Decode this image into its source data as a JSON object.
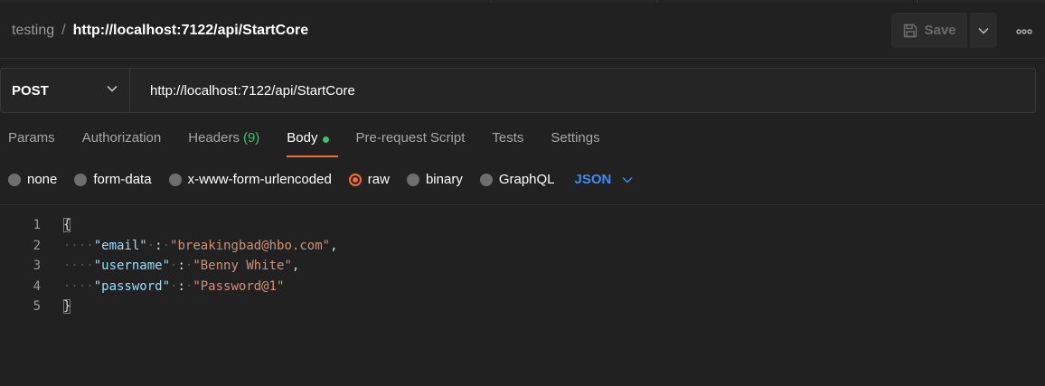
{
  "header": {
    "breadcrumb_parent": "testing",
    "breadcrumb_separator": "/",
    "breadcrumb_current": "http://localhost:7122/api/StartCore",
    "save_label": "Save"
  },
  "request": {
    "method": "POST",
    "url": "http://localhost:7122/api/StartCore"
  },
  "tabs": [
    {
      "label": "Params"
    },
    {
      "label": "Authorization"
    },
    {
      "label": "Headers",
      "count": "(9)"
    },
    {
      "label": "Body",
      "active": true
    },
    {
      "label": "Pre-request Script"
    },
    {
      "label": "Tests"
    },
    {
      "label": "Settings"
    }
  ],
  "body_types": [
    {
      "label": "none"
    },
    {
      "label": "form-data"
    },
    {
      "label": "x-www-form-urlencoded"
    },
    {
      "label": "raw",
      "selected": true
    },
    {
      "label": "binary"
    },
    {
      "label": "GraphQL"
    }
  ],
  "body_format": "JSON",
  "editor": {
    "line_numbers": [
      "1",
      "2",
      "3",
      "4",
      "5"
    ],
    "open_brace": "{",
    "close_brace": "}",
    "fields": [
      {
        "key": "\"email\"",
        "value": "\"breakingbad@hbo.com\"",
        "comma": ","
      },
      {
        "key": "\"username\"",
        "value": "\"Benny White\"",
        "comma": ","
      },
      {
        "key": "\"password\"",
        "value": "\"Password@1\"",
        "comma": ""
      }
    ]
  },
  "colors": {
    "background": "#212121",
    "accent": "#f26b3a",
    "success": "#3cc26a",
    "link": "#3d8bf2",
    "json_key": "#9cdcfe",
    "json_string": "#ce9178"
  },
  "icons": {
    "save": "save-icon",
    "save_dropdown": "chevron-down-icon",
    "more": "more-horizontal-icon",
    "method_dropdown": "chevron-down-icon",
    "format_dropdown": "chevron-down-icon"
  }
}
